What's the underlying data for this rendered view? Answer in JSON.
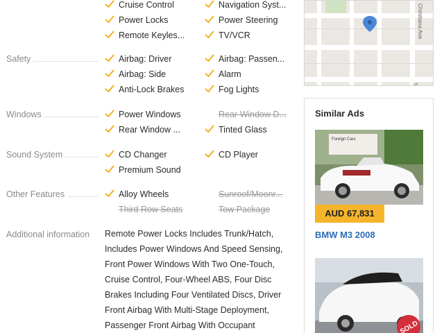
{
  "features": [
    {
      "id": "top",
      "label": "",
      "items": [
        {
          "text": "Cruise Control",
          "on": true
        },
        {
          "text": "Navigation Syst...",
          "on": true
        },
        {
          "text": "Power Locks",
          "on": true
        },
        {
          "text": "Power Steering",
          "on": true
        },
        {
          "text": "Remote Keyles...",
          "on": true
        },
        {
          "text": "TV/VCR",
          "on": true
        }
      ]
    },
    {
      "id": "safety",
      "label": "Safety",
      "items": [
        {
          "text": "Airbag: Driver",
          "on": true
        },
        {
          "text": "Airbag: Passen...",
          "on": true
        },
        {
          "text": "Airbag: Side",
          "on": true
        },
        {
          "text": "Alarm",
          "on": true
        },
        {
          "text": "Anti-Lock Brakes",
          "on": true
        },
        {
          "text": "Fog Lights",
          "on": true
        }
      ]
    },
    {
      "id": "windows",
      "label": "Windows",
      "items": [
        {
          "text": "Power Windows",
          "on": true
        },
        {
          "text": "Rear Window D...",
          "on": false
        },
        {
          "text": "Rear Window ...",
          "on": true
        },
        {
          "text": "Tinted Glass",
          "on": true
        }
      ]
    },
    {
      "id": "sound",
      "label": "Sound System",
      "items": [
        {
          "text": "CD Changer",
          "on": true
        },
        {
          "text": "CD Player",
          "on": true
        },
        {
          "text": "Premium Sound",
          "on": true
        }
      ]
    },
    {
      "id": "other",
      "label": "Other Features",
      "items": [
        {
          "text": "Alloy Wheels",
          "on": true
        },
        {
          "text": "Sunroof/Moonr...",
          "on": false
        },
        {
          "text": "Third Row Seats",
          "on": false
        },
        {
          "text": "Tow Package",
          "on": false
        }
      ]
    }
  ],
  "additional": {
    "label": "Additional information",
    "text": "Remote Power Locks Includes Trunk/Hatch, Includes Power Windows And Speed Sensing, Front Power Windows With Two One-Touch, Cruise Control, Four-Wheel ABS, Four Disc Brakes Including Four Ventilated Discs, Driver Front Airbag With Multi-Stage Deployment, Passenger Front Airbag With Occupant"
  },
  "map": {
    "street_label": "Christiana Ave",
    "street_label_2": "S"
  },
  "similar": {
    "title": "Similar Ads",
    "ads": [
      {
        "price": "AUD 67,831",
        "title": "BMW M3 2008",
        "sign_text": "Foreign Cars"
      },
      {
        "badge": "SOLD"
      }
    ]
  },
  "colors": {
    "accent": "#f5b52b",
    "link": "#2a6db5",
    "muted": "#8a8a8a"
  }
}
